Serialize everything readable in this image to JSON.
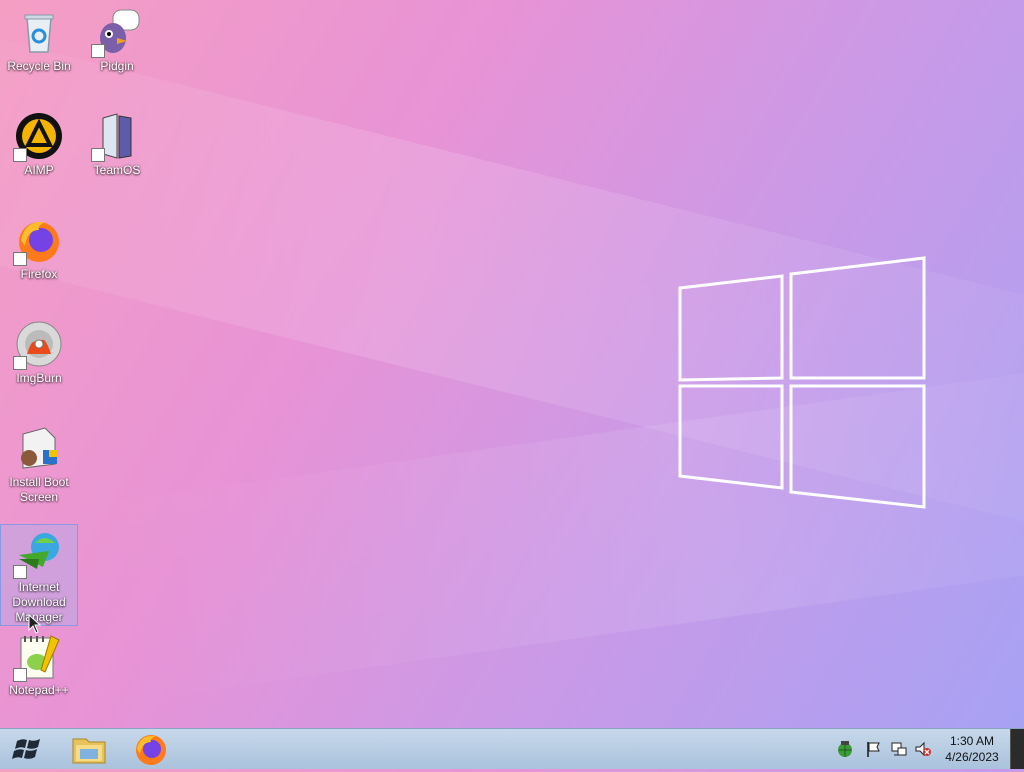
{
  "desktop": {
    "icons": [
      {
        "label": "Recycle Bin",
        "icon": "recycle-bin-icon"
      },
      {
        "label": "Pidgin",
        "icon": "pidgin-icon"
      },
      {
        "label": "AIMP",
        "icon": "aimp-icon"
      },
      {
        "label": "TeamOS",
        "icon": "teamos-icon"
      },
      {
        "label": "Firefox",
        "icon": "firefox-icon"
      },
      {
        "label": "ImgBurn",
        "icon": "imgburn-icon"
      },
      {
        "label": "Install Boot Screen",
        "icon": "install-boot-screen-icon"
      },
      {
        "label": "Internet Download Manager",
        "icon": "idm-icon"
      },
      {
        "label": "Notepad++",
        "icon": "notepadpp-icon"
      }
    ],
    "selected_icon": "Internet Download Manager"
  },
  "taskbar": {
    "start": "start-orb-icon",
    "pinned": [
      {
        "icon": "file-explorer-icon"
      },
      {
        "icon": "firefox-icon"
      }
    ],
    "tray": [
      {
        "icon": "network-globe-icon"
      },
      {
        "icon": "action-center-flag-icon"
      },
      {
        "icon": "network-icon"
      },
      {
        "icon": "volume-muted-icon"
      }
    ],
    "clock": {
      "time": "1:30 AM",
      "date": "4/26/2023"
    }
  },
  "colors": {
    "taskbar": "#b8cde3",
    "wallpaper_left": "#f59ec4",
    "wallpaper_right": "#a6a2f4",
    "selection": "#a0b4f0"
  }
}
